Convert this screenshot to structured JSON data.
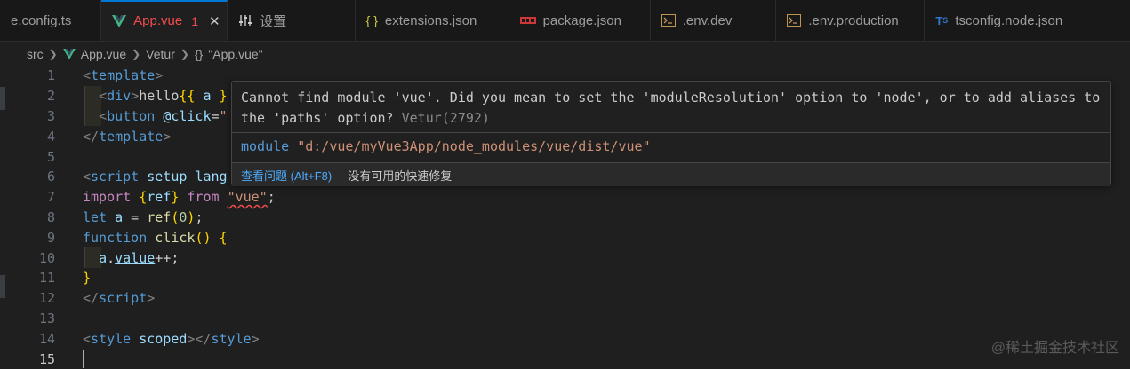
{
  "colors": {
    "accent": "#0078d4",
    "error": "#f14c4c",
    "vue_green": "#41b883",
    "link": "#4daafc"
  },
  "tabs": [
    {
      "label": "e.config.ts",
      "icon": "typescript-icon",
      "active": false
    },
    {
      "label": "App.vue",
      "icon": "vue-icon",
      "active": true,
      "badge": "1",
      "close": "✕"
    },
    {
      "label": "设置",
      "icon": "settings-sliders-icon",
      "active": false
    },
    {
      "label": "extensions.json",
      "icon": "json-braces-icon",
      "active": false
    },
    {
      "label": "package.json",
      "icon": "npm-icon",
      "active": false
    },
    {
      "label": ".env.dev",
      "icon": "terminal-icon",
      "active": false
    },
    {
      "label": ".env.production",
      "icon": "terminal-icon",
      "active": false
    },
    {
      "label": "tsconfig.node.json",
      "icon": "tsconfig-icon",
      "active": false
    }
  ],
  "breadcrumb": {
    "items": [
      "src",
      "App.vue",
      "Vetur",
      "\"App.vue\""
    ],
    "braces_glyph": "{}"
  },
  "editor": {
    "line_numbers": [
      "1",
      "2",
      "3",
      "4",
      "5",
      "6",
      "7",
      "8",
      "9",
      "10",
      "11",
      "12",
      "13",
      "14",
      "15"
    ],
    "current_line": "15"
  },
  "hover": {
    "message": "Cannot find module 'vue'. Did you mean to set the 'moduleResolution' option to 'node', or to add aliases to the 'paths' option?",
    "source": "Vetur(2792)",
    "module_keyword": "module",
    "module_path": "\"d:/vue/myVue3App/node_modules/vue/dist/vue\"",
    "view_problem": "查看问题 (Alt+F8)",
    "no_quick_fix": "没有可用的快速修复"
  },
  "watermark": "@稀土掘金技术社区"
}
